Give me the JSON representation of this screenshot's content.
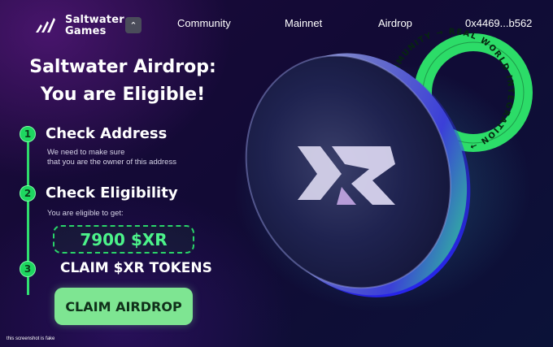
{
  "brand": {
    "line1": "Saltwater",
    "line2": "Games"
  },
  "nav": {
    "collapse_icon": "chevron-up-icon",
    "community": "Community",
    "mainnet": "Mainnet",
    "airdrop": "Airdrop",
    "wallet": "0x4469...b562"
  },
  "hero": {
    "title_line1": "Saltwater Airdrop:",
    "title_line2": "You are Eligible!"
  },
  "steps": [
    {
      "number": "1",
      "title": "Check Address",
      "desc_line1": "We need to make sure",
      "desc_line2": "that you are the owner of this address"
    },
    {
      "number": "2",
      "title": "Check Eligibility",
      "desc": "You are eligible to get:",
      "amount": "7900 $XR"
    },
    {
      "number": "3",
      "title": "CLAIM $XR TOKENS"
    }
  ],
  "claim_button": "CLAIM AIRDROP",
  "ring_text": "MMUNITY → REAL WORLD INTEGRATION →",
  "footnote": "this screenshot is fake",
  "colors": {
    "accent_green": "#1ed760",
    "button_green": "#7ee592",
    "ring_green": "#2ee86c"
  }
}
